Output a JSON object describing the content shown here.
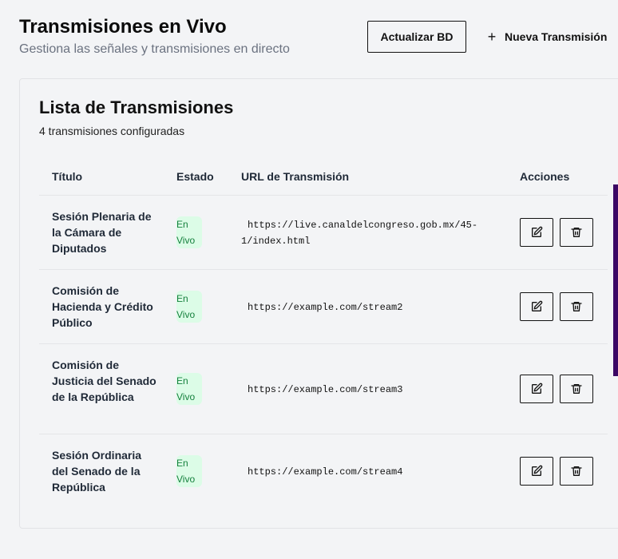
{
  "header": {
    "title": "Transmisiones en Vivo",
    "subtitle": "Gestiona las señales y transmisiones en directo",
    "refresh_label": "Actualizar BD",
    "new_label": "Nueva Transmisión"
  },
  "card": {
    "title": "Lista de Transmisiones",
    "subtitle": "4 transmisiones configuradas"
  },
  "table": {
    "columns": {
      "title": "Título",
      "status": "Estado",
      "url": "URL de Transmisión",
      "actions": "Acciones"
    },
    "rows": [
      {
        "title": "Sesión Plenaria de la Cámara de Diputados",
        "status_line1": "En",
        "status_line2": "Vivo",
        "url": "https://live.canaldelcongreso.gob.mx/45-1/index.html"
      },
      {
        "title": "Comisión de Hacienda y Crédito Público",
        "status_line1": "En",
        "status_line2": "Vivo",
        "url": "https://example.com/stream2"
      },
      {
        "title": "Comisión de Justicia del Senado de la República",
        "status_line1": "En",
        "status_line2": "Vivo",
        "url": "https://example.com/stream3"
      },
      {
        "title": "Sesión Ordinaria del Senado de la República",
        "status_line1": "En",
        "status_line2": "Vivo",
        "url": "https://example.com/stream4"
      }
    ]
  },
  "icons": {
    "edit": "edit-icon",
    "delete": "trash-icon",
    "add": "plus-icon"
  },
  "colors": {
    "badge_bg": "#dcfce7",
    "badge_text": "#15803d",
    "accent_strip": "#3b0764"
  }
}
